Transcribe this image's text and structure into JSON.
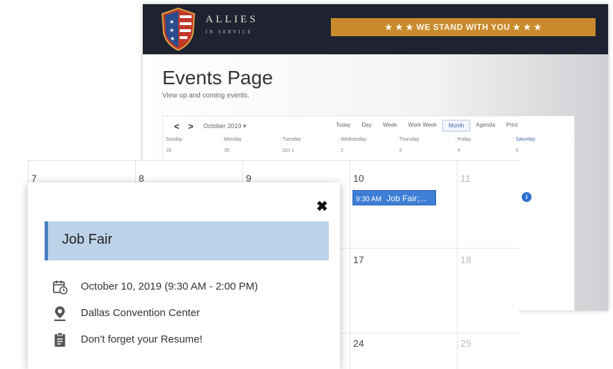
{
  "back_window": {
    "logo": {
      "name": "ALLIES",
      "subtitle": "IN SERVICE"
    },
    "banner": "★ ★ ★ WE STAND WITH YOU ★ ★ ★",
    "page_title": "Events Page",
    "page_subtitle": "View up and coming events.",
    "calendar": {
      "month_label": "October 2019 ▾",
      "views": [
        "Today",
        "Day",
        "Week",
        "Work Week",
        "Month",
        "Agenda",
        "Print"
      ],
      "active_view": "Month",
      "weekdays": [
        "Sunday",
        "Monday",
        "Tuesday",
        "Wednesday",
        "Thursday",
        "Friday",
        "Saturday"
      ],
      "first_row_days": [
        "29",
        "30",
        "Oct 1",
        "2",
        "3",
        "4",
        "5"
      ]
    }
  },
  "calendar_overlay": {
    "days_row1": [
      "7",
      "8",
      "9",
      "10",
      "11"
    ],
    "days_row2": [
      "17",
      "18"
    ],
    "days_row3": [
      "24",
      "25"
    ],
    "event_chip": {
      "time": "9:30 AM",
      "label": "Job Fair;..."
    }
  },
  "event_popup": {
    "title": "Job Fair",
    "date": "October 10, 2019 (9:30 AM - 2:00 PM)",
    "location": "Dallas Convention Center",
    "note": "Don't forget your Resume!"
  },
  "colors": {
    "header_bg": "#1f2230",
    "banner": "#c88a2c",
    "event_chip": "#3e7fd6",
    "popup_title_bg": "#bcd2e8"
  }
}
